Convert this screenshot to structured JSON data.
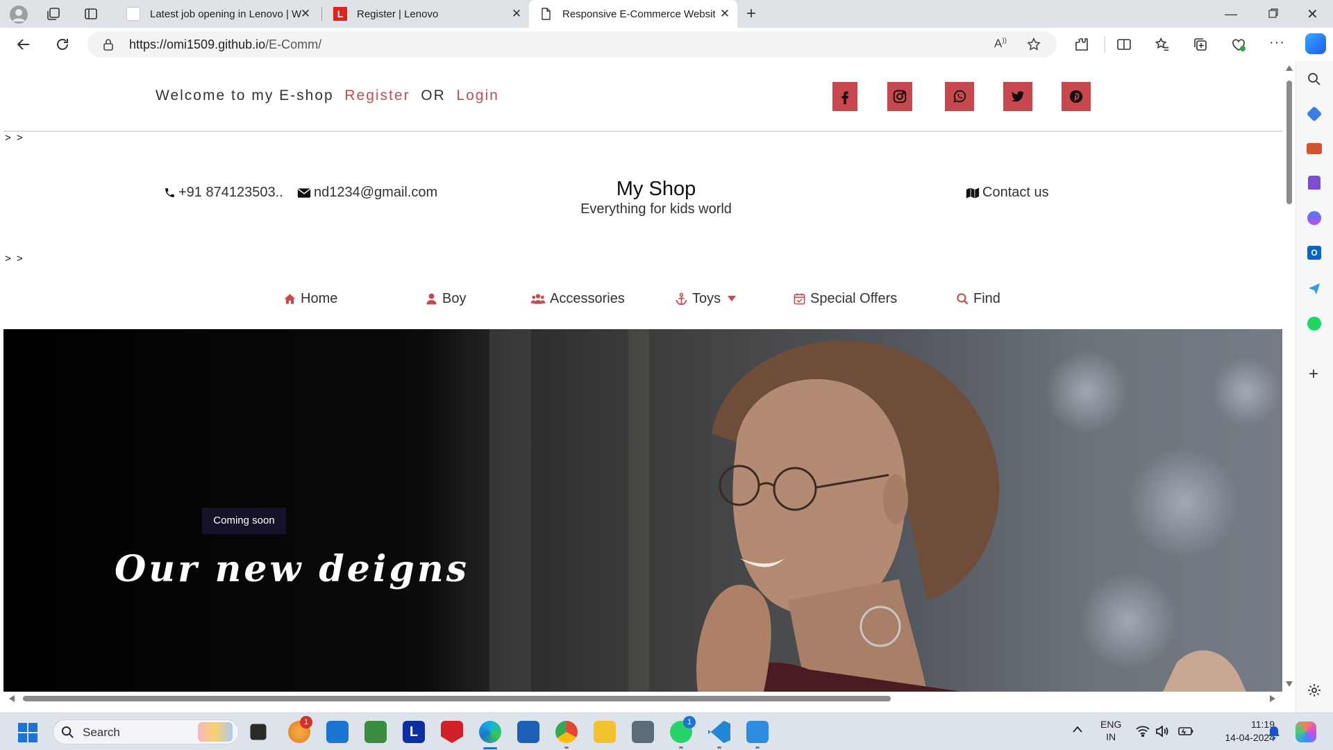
{
  "browser": {
    "tabs": [
      {
        "title": "Latest job opening in Lenovo | W",
        "active": false
      },
      {
        "title": "Register | Lenovo",
        "active": false
      },
      {
        "title": "Responsive E-Commerce Website",
        "active": true
      }
    ],
    "url_host": "https://omi1509.github.io",
    "url_path": "/E-Comm/",
    "window_controls": [
      "minimize-icon",
      "restore-icon",
      "close-icon"
    ]
  },
  "page": {
    "topbar": {
      "welcome": "Welcome to my E-shop",
      "register": "Register",
      "or": "OR",
      "login": "Login",
      "social_icons": [
        "facebook-icon",
        "instagram-icon",
        "whatsapp-icon",
        "twitter-icon",
        "pinterest-icon"
      ],
      "accent_color": "#c9484d"
    },
    "stray_text": "> >",
    "header": {
      "phone": "+91 874123503..",
      "email": "nd1234@gmail.com",
      "shop_name": "My Shop",
      "tagline": "Everything for kids world",
      "contact": "Contact us"
    },
    "nav": {
      "home": "Home",
      "boy": "Boy",
      "accessories": "Accessories",
      "toys": "Toys",
      "special_offers": "Special Offers",
      "find": "Find"
    },
    "hero": {
      "badge": "Coming soon",
      "headline": "Our new deigns"
    }
  },
  "taskbar": {
    "search_placeholder": "Search",
    "language": "ENG",
    "region": "IN",
    "time": "11:19",
    "date": "14-04-2024",
    "badge_count_1": "1",
    "badge_count_2": "1"
  }
}
